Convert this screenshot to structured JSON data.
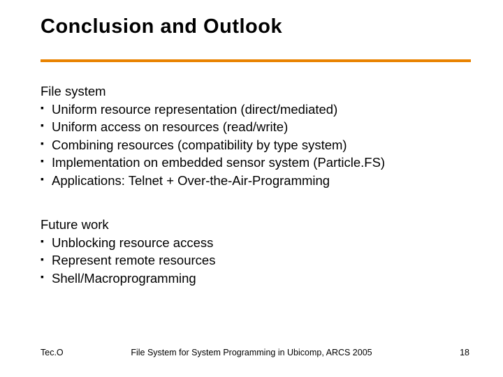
{
  "title": "Conclusion and Outlook",
  "sections": {
    "filesystem": {
      "heading": "File system",
      "items": [
        "Uniform resource representation (direct/mediated)",
        "Uniform access on resources (read/write)",
        "Combining resources (compatibility by type system)",
        "Implementation on embedded sensor system (Particle.FS)",
        "Applications: Telnet + Over-the-Air-Programming"
      ]
    },
    "future": {
      "heading": "Future work",
      "items": [
        "Unblocking resource access",
        "Represent remote resources",
        "Shell/Macroprogramming"
      ]
    }
  },
  "footer": {
    "left": "Tec.O",
    "center": "File System for System Programming in Ubicomp, ARCS 2005",
    "right": "18"
  }
}
